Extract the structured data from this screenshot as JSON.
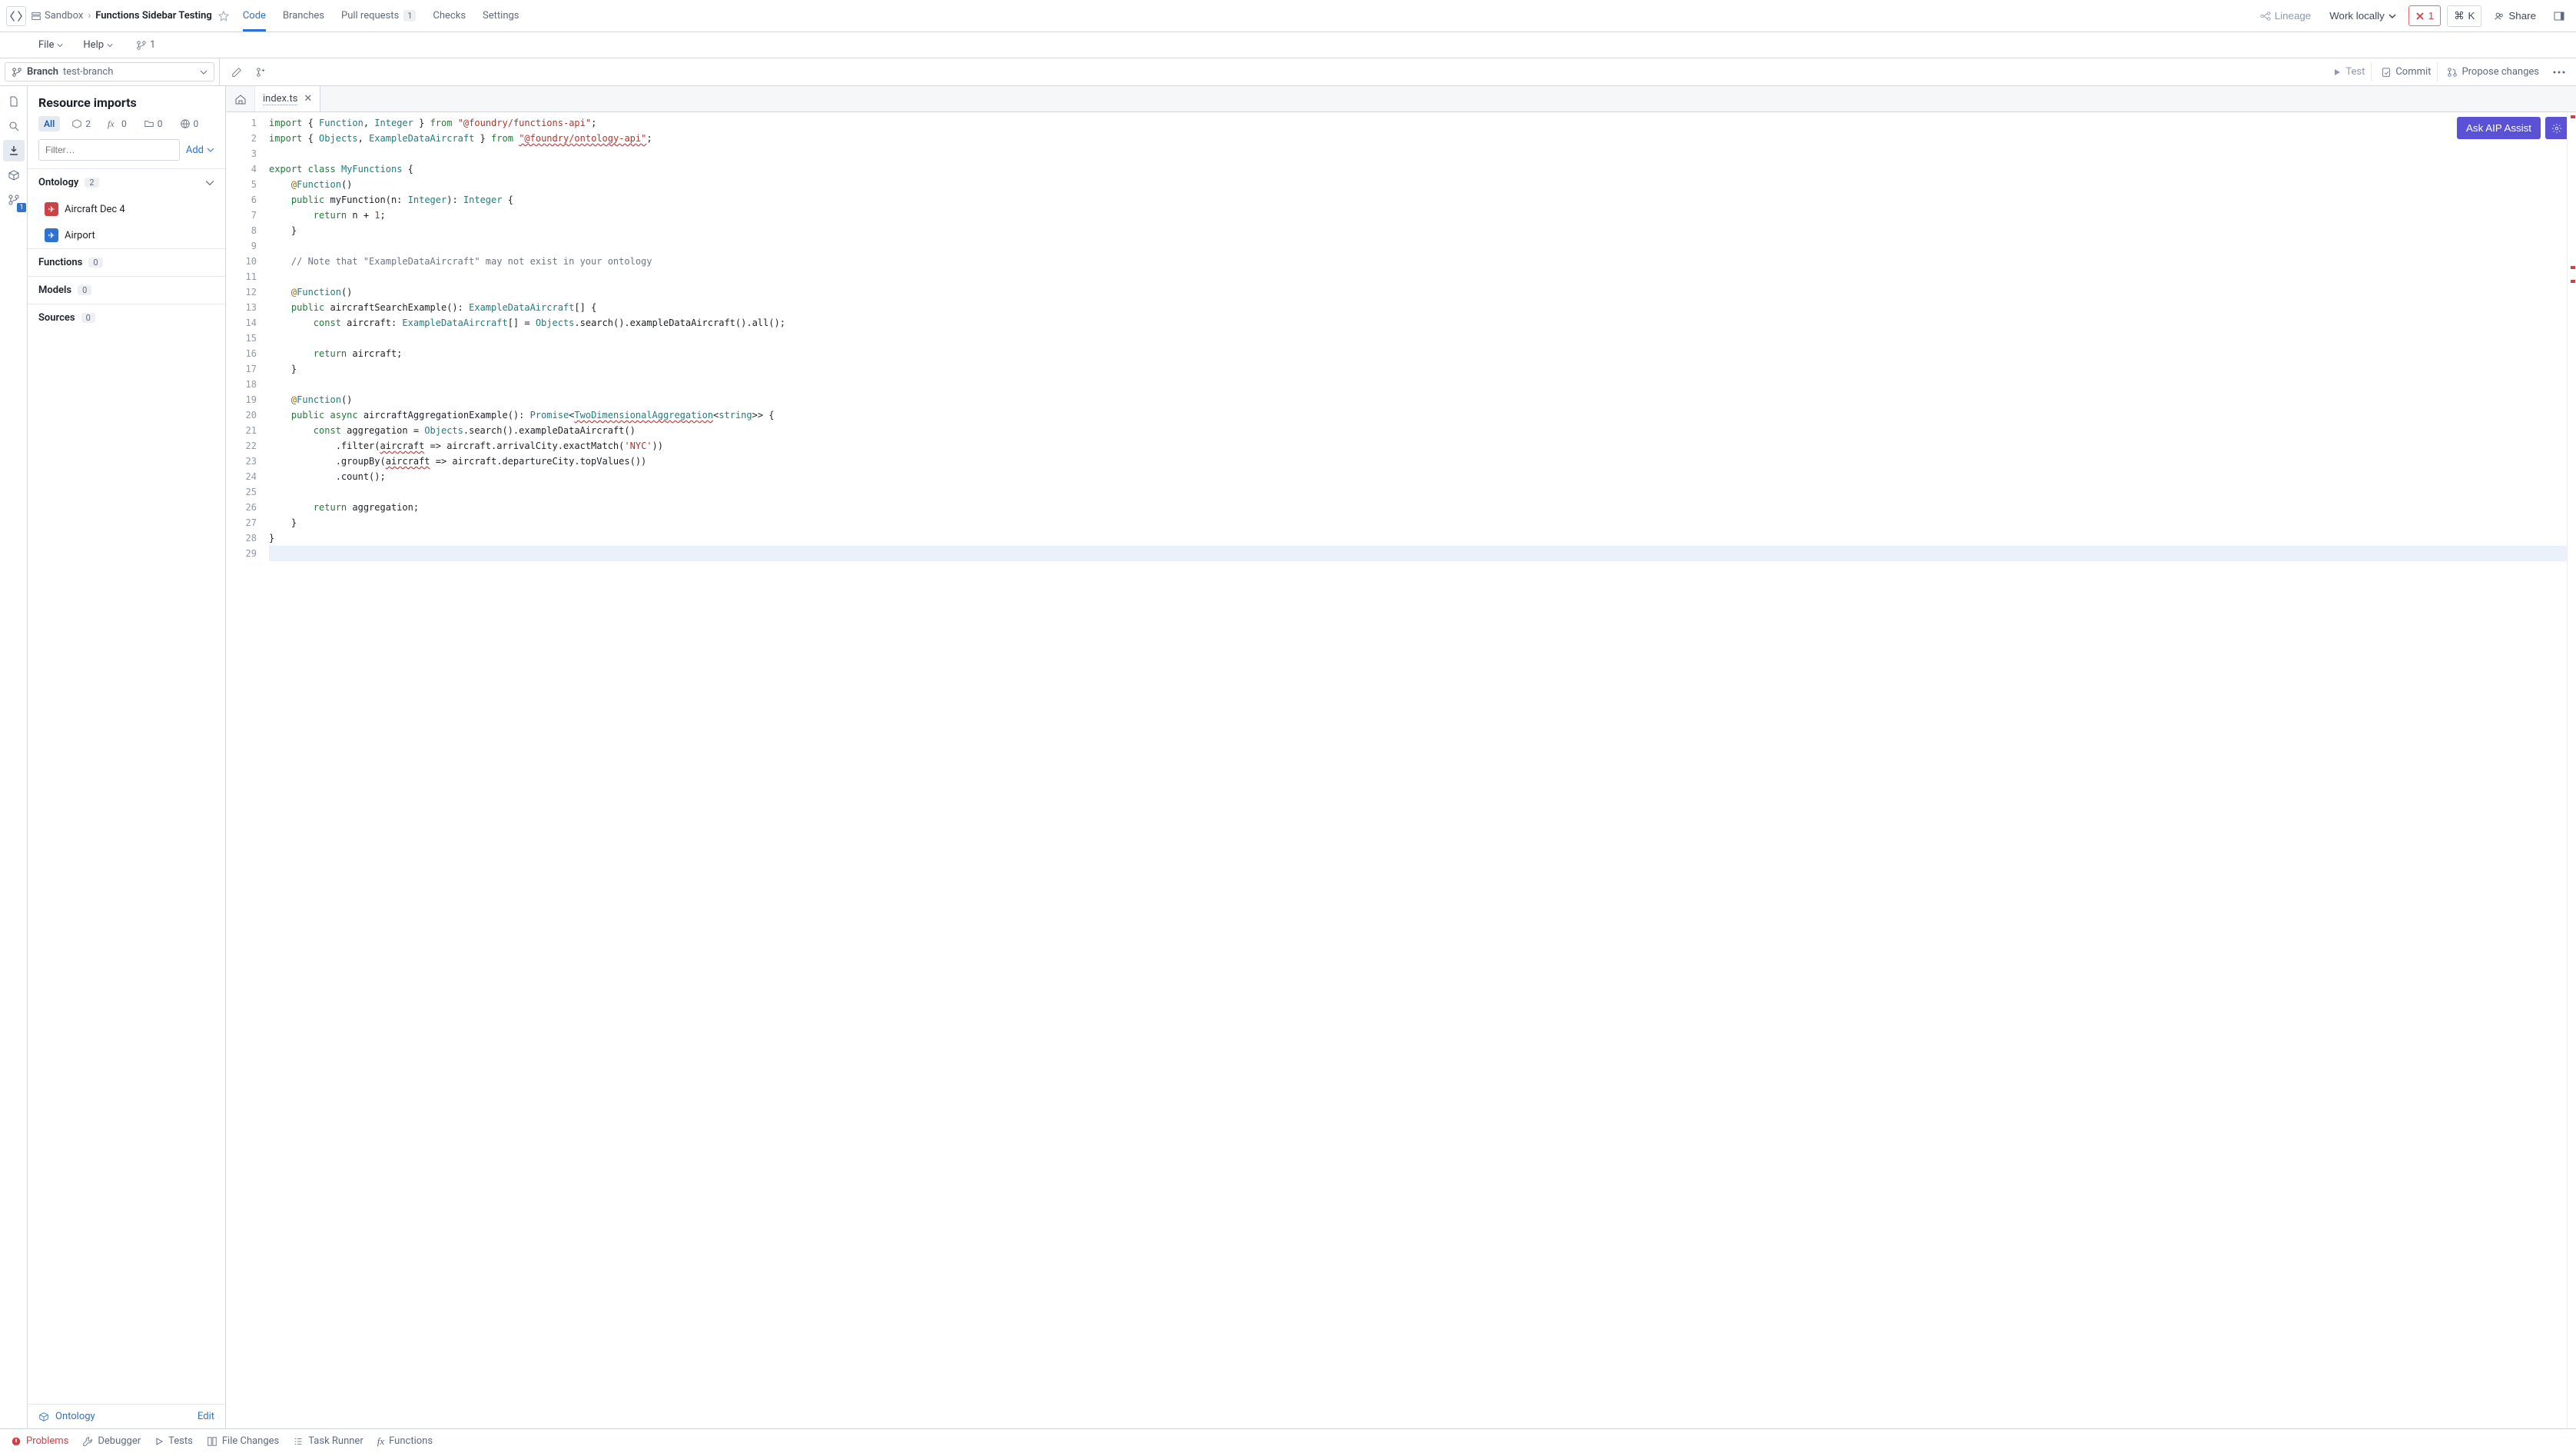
{
  "header": {
    "breadcrumbs": [
      {
        "label": "Sandbox",
        "active": false
      },
      {
        "label": "Functions Sidebar Testing",
        "active": true
      }
    ],
    "tabs": [
      {
        "label": "Code",
        "active": true
      },
      {
        "label": "Branches"
      },
      {
        "label": "Pull requests",
        "badge": "1"
      },
      {
        "label": "Checks"
      },
      {
        "label": "Settings"
      }
    ],
    "right": {
      "lineage": "Lineage",
      "work_locally": "Work locally",
      "close_count": "1",
      "cmdk": "K",
      "share": "Share"
    }
  },
  "menubar": {
    "file": "File",
    "help": "Help",
    "branch_count": "1"
  },
  "branch": {
    "label": "Branch",
    "value": "test-branch",
    "actions": {
      "test": "Test",
      "commit": "Commit",
      "propose": "Propose changes"
    }
  },
  "leftrail": {
    "active_index": 2,
    "items": [
      "files-icon",
      "search-icon",
      "download-icon",
      "package-icon",
      "graph-icon"
    ],
    "download_badge": "1"
  },
  "sidebar": {
    "title": "Resource imports",
    "chips": [
      {
        "label": "All",
        "selected": true
      },
      {
        "icon": "box",
        "count": "2"
      },
      {
        "icon": "fx",
        "count": "0"
      },
      {
        "icon": "folder",
        "count": "0"
      },
      {
        "icon": "globe",
        "count": "0"
      }
    ],
    "filter_placeholder": "Filter…",
    "add_label": "Add",
    "groups": [
      {
        "title": "Ontology",
        "count": "2",
        "expanded": true,
        "items": [
          {
            "icon": "red",
            "glyph": "✈",
            "label": "Aircraft Dec 4"
          },
          {
            "icon": "blue",
            "glyph": "✈",
            "label": "Airport"
          }
        ]
      },
      {
        "title": "Functions",
        "count": "0"
      },
      {
        "title": "Models",
        "count": "0"
      },
      {
        "title": "Sources",
        "count": "0"
      }
    ],
    "footer": {
      "ontology": "Ontology",
      "edit": "Edit"
    }
  },
  "editor": {
    "tab_name": "index.ts",
    "aip_label": "Ask AIP Assist",
    "line_count": 29,
    "current_line": 29,
    "code_lines": [
      [
        {
          "c": "tk-kw",
          "t": "import"
        },
        {
          "t": " { "
        },
        {
          "c": "tk-ty",
          "t": "Function"
        },
        {
          "t": ", "
        },
        {
          "c": "tk-ty",
          "t": "Integer"
        },
        {
          "t": " } "
        },
        {
          "c": "tk-kw",
          "t": "from"
        },
        {
          "t": " "
        },
        {
          "c": "tk-str",
          "t": "\"@foundry/functions-api\""
        },
        {
          "t": ";"
        }
      ],
      [
        {
          "c": "tk-kw",
          "t": "import"
        },
        {
          "t": " { "
        },
        {
          "c": "tk-ty",
          "t": "Objects"
        },
        {
          "t": ", "
        },
        {
          "c": "tk-ty",
          "t": "ExampleDataAircraft"
        },
        {
          "t": " } "
        },
        {
          "c": "tk-kw",
          "t": "from"
        },
        {
          "t": " "
        },
        {
          "c": "tk-str tk-err",
          "t": "\"@foundry/ontology-api\""
        },
        {
          "t": ";"
        }
      ],
      [
        {
          "t": ""
        }
      ],
      [
        {
          "c": "tk-kw",
          "t": "export"
        },
        {
          "t": " "
        },
        {
          "c": "tk-kw",
          "t": "class"
        },
        {
          "t": " "
        },
        {
          "c": "tk-ty",
          "t": "MyFunctions"
        },
        {
          "t": " {"
        }
      ],
      [
        {
          "t": "    "
        },
        {
          "c": "tk-dec",
          "t": "@"
        },
        {
          "c": "tk-ty",
          "t": "Function"
        },
        {
          "t": "()"
        }
      ],
      [
        {
          "t": "    "
        },
        {
          "c": "tk-kw",
          "t": "public"
        },
        {
          "t": " myFunction(n: "
        },
        {
          "c": "tk-ty",
          "t": "Integer"
        },
        {
          "t": "): "
        },
        {
          "c": "tk-ty",
          "t": "Integer"
        },
        {
          "t": " {"
        }
      ],
      [
        {
          "t": "        "
        },
        {
          "c": "tk-kw",
          "t": "return"
        },
        {
          "t": " n + "
        },
        {
          "c": "tk-str",
          "t": "1"
        },
        {
          "t": ";"
        }
      ],
      [
        {
          "t": "    }"
        }
      ],
      [
        {
          "t": ""
        }
      ],
      [
        {
          "t": "    "
        },
        {
          "c": "tk-cm",
          "t": "// Note that \"ExampleDataAircraft\" may not exist in your ontology"
        }
      ],
      [
        {
          "t": ""
        }
      ],
      [
        {
          "t": "    "
        },
        {
          "c": "tk-dec",
          "t": "@"
        },
        {
          "c": "tk-ty",
          "t": "Function"
        },
        {
          "t": "()"
        }
      ],
      [
        {
          "t": "    "
        },
        {
          "c": "tk-kw",
          "t": "public"
        },
        {
          "t": " aircraftSearchExample(): "
        },
        {
          "c": "tk-ty",
          "t": "ExampleDataAircraft"
        },
        {
          "t": "[] {"
        }
      ],
      [
        {
          "t": "        "
        },
        {
          "c": "tk-kw",
          "t": "const"
        },
        {
          "t": " aircraft: "
        },
        {
          "c": "tk-ty",
          "t": "ExampleDataAircraft"
        },
        {
          "t": "[] = "
        },
        {
          "c": "tk-ty",
          "t": "Objects"
        },
        {
          "t": ".search().exampleDataAircraft().all();"
        }
      ],
      [
        {
          "t": ""
        }
      ],
      [
        {
          "t": "        "
        },
        {
          "c": "tk-kw",
          "t": "return"
        },
        {
          "t": " aircraft;"
        }
      ],
      [
        {
          "t": "    }"
        }
      ],
      [
        {
          "t": ""
        }
      ],
      [
        {
          "t": "    "
        },
        {
          "c": "tk-dec",
          "t": "@"
        },
        {
          "c": "tk-ty",
          "t": "Function"
        },
        {
          "t": "()"
        }
      ],
      [
        {
          "t": "    "
        },
        {
          "c": "tk-kw",
          "t": "public"
        },
        {
          "t": " "
        },
        {
          "c": "tk-kw",
          "t": "async"
        },
        {
          "t": " aircraftAggregationExample(): "
        },
        {
          "c": "tk-ty",
          "t": "Promise"
        },
        {
          "t": "<"
        },
        {
          "c": "tk-ty tk-err",
          "t": "TwoDimensionalAggregation"
        },
        {
          "t": "<"
        },
        {
          "c": "tk-ty",
          "t": "string"
        },
        {
          "t": ">> {"
        }
      ],
      [
        {
          "t": "        "
        },
        {
          "c": "tk-kw",
          "t": "const"
        },
        {
          "t": " aggregation = "
        },
        {
          "c": "tk-ty",
          "t": "Objects"
        },
        {
          "t": ".search().exampleDataAircraft()"
        }
      ],
      [
        {
          "t": "            .filter("
        },
        {
          "c": "tk-err",
          "t": "aircraft"
        },
        {
          "t": " => aircraft.arrivalCity.exactMatch("
        },
        {
          "c": "tk-str",
          "t": "'NYC'"
        },
        {
          "t": "))"
        }
      ],
      [
        {
          "t": "            .groupBy("
        },
        {
          "c": "tk-err",
          "t": "aircraft"
        },
        {
          "t": " => aircraft.departureCity.topValues())"
        }
      ],
      [
        {
          "t": "            .count();"
        }
      ],
      [
        {
          "t": ""
        }
      ],
      [
        {
          "t": "        "
        },
        {
          "c": "tk-kw",
          "t": "return"
        },
        {
          "t": " aggregation;"
        }
      ],
      [
        {
          "t": "    }"
        }
      ],
      [
        {
          "t": "}"
        }
      ],
      [
        {
          "t": ""
        }
      ]
    ]
  },
  "bottombar": {
    "items": [
      {
        "id": "problems",
        "label": "Problems",
        "err": true
      },
      {
        "id": "debugger",
        "label": "Debugger"
      },
      {
        "id": "tests",
        "label": "Tests"
      },
      {
        "id": "filechanges",
        "label": "File Changes"
      },
      {
        "id": "taskrunner",
        "label": "Task Runner"
      },
      {
        "id": "functions",
        "label": "Functions"
      }
    ]
  }
}
